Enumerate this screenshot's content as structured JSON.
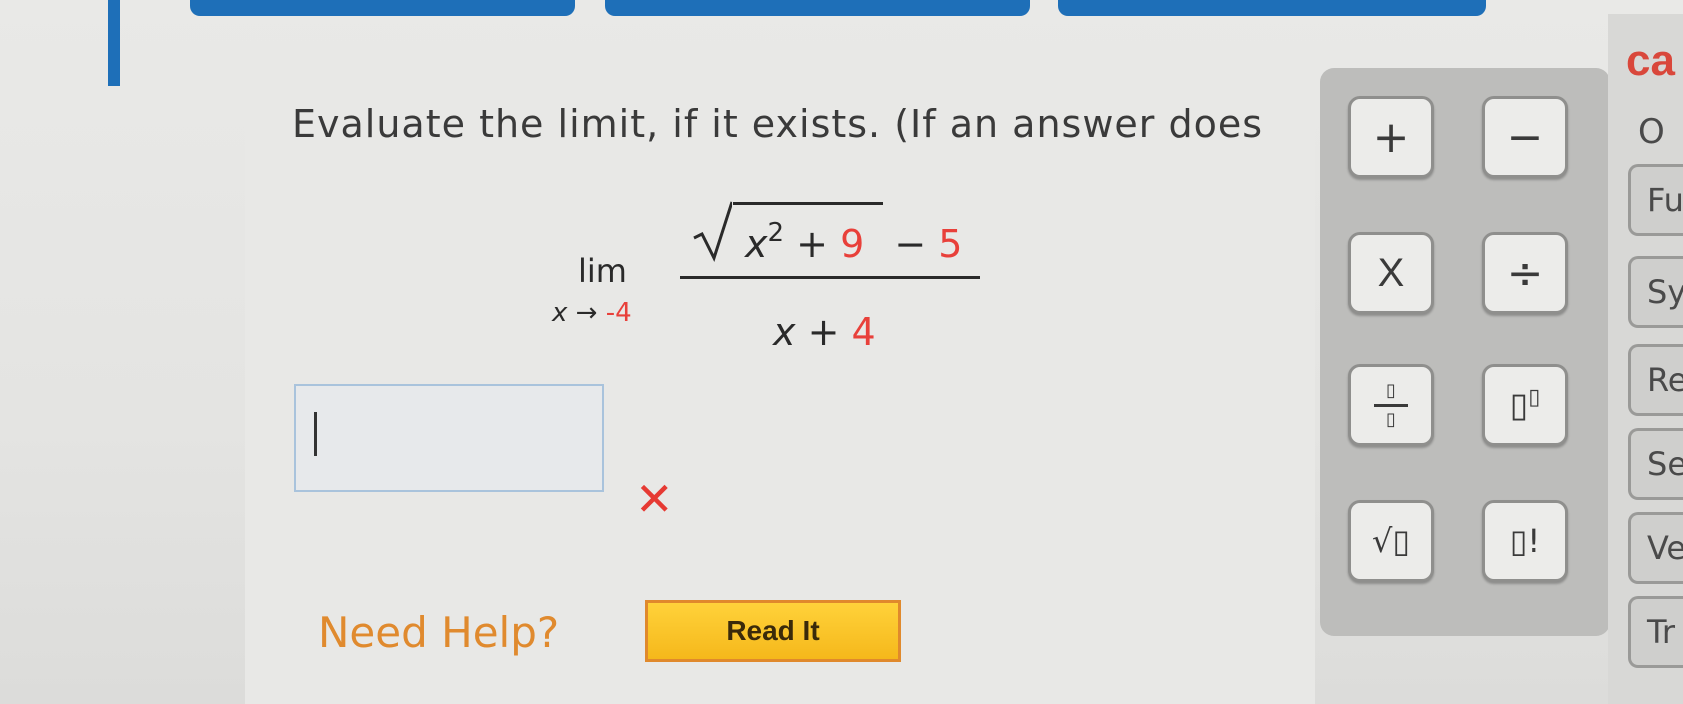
{
  "question": {
    "prompt": "Evaluate the limit, if it exists. (If an answer does",
    "limit_word": "lim",
    "limit_var": "x",
    "limit_arrow": "→",
    "limit_target": "-4",
    "numerator": {
      "var": "x",
      "exponent": "2",
      "plus": "+",
      "constant": "9",
      "minus": "−",
      "subtract": "5"
    },
    "denominator": {
      "var": "x",
      "plus": "+",
      "constant": "4"
    }
  },
  "answer": {
    "value": "",
    "status_icon": "✕"
  },
  "help": {
    "label": "Need Help?",
    "read_button": "Read It"
  },
  "keypad": {
    "keys": [
      {
        "name": "plus",
        "label": "+"
      },
      {
        "name": "minus",
        "label": "−"
      },
      {
        "name": "times",
        "label": "X"
      },
      {
        "name": "divide",
        "label": "÷"
      },
      {
        "name": "fraction",
        "label": "▯"
      },
      {
        "name": "power",
        "label": "▯▯"
      },
      {
        "name": "sqrt",
        "label": "√▯"
      },
      {
        "name": "factorial",
        "label": "▯!"
      }
    ]
  },
  "side_panel": {
    "heading": "ca",
    "subheading": "O",
    "tabs": [
      "Fu",
      "Sy",
      "Re",
      "Se",
      "Ve",
      "Tr"
    ]
  },
  "colors": {
    "accent_blue": "#1e6fb8",
    "red_highlight": "#e8403a",
    "help_orange": "#e08a2e",
    "button_yellow": "#f5b81b"
  }
}
